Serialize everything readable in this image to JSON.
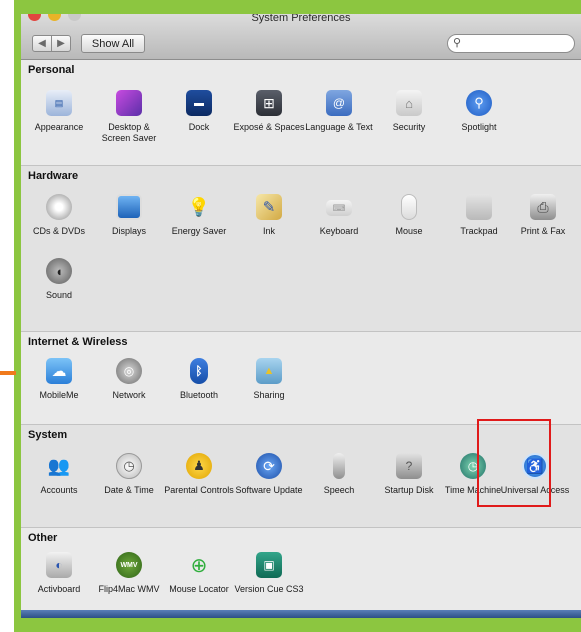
{
  "window": {
    "title": "System Preferences",
    "back_label": "◀",
    "forward_label": "▶",
    "show_all_label": "Show All",
    "search_placeholder": ""
  },
  "colors": {
    "frame_green": "#8cc640",
    "orange_mark": "#f07a1c",
    "highlight_red": "#e01a1a"
  },
  "sections": {
    "personal": {
      "title": "Personal",
      "items": [
        {
          "label": "Appearance",
          "icon": "appearance-icon"
        },
        {
          "label": "Desktop & Screen Saver",
          "icon": "desktop-icon"
        },
        {
          "label": "Dock",
          "icon": "dock-icon"
        },
        {
          "label": "Exposé & Spaces",
          "icon": "expose-icon"
        },
        {
          "label": "Language & Text",
          "icon": "language-icon"
        },
        {
          "label": "Security",
          "icon": "security-icon"
        },
        {
          "label": "Spotlight",
          "icon": "spotlight-icon"
        }
      ]
    },
    "hardware": {
      "title": "Hardware",
      "items": [
        {
          "label": "CDs & DVDs",
          "icon": "cd-icon"
        },
        {
          "label": "Displays",
          "icon": "display-icon"
        },
        {
          "label": "Energy Saver",
          "icon": "lightbulb-icon"
        },
        {
          "label": "Ink",
          "icon": "ink-icon"
        },
        {
          "label": "Keyboard",
          "icon": "keyboard-icon"
        },
        {
          "label": "Mouse",
          "icon": "mouse-icon"
        },
        {
          "label": "Trackpad",
          "icon": "trackpad-icon"
        },
        {
          "label": "Print & Fax",
          "icon": "printer-icon"
        },
        {
          "label": "Sound",
          "icon": "speaker-icon"
        }
      ]
    },
    "internet": {
      "title": "Internet & Wireless",
      "items": [
        {
          "label": "MobileMe",
          "icon": "cloud-icon"
        },
        {
          "label": "Network",
          "icon": "globe-icon"
        },
        {
          "label": "Bluetooth",
          "icon": "bluetooth-icon"
        },
        {
          "label": "Sharing",
          "icon": "folder-icon"
        }
      ]
    },
    "system": {
      "title": "System",
      "items": [
        {
          "label": "Accounts",
          "icon": "users-icon"
        },
        {
          "label": "Date & Time",
          "icon": "clock-icon"
        },
        {
          "label": "Parental Controls",
          "icon": "parental-icon"
        },
        {
          "label": "Software Update",
          "icon": "update-icon"
        },
        {
          "label": "Speech",
          "icon": "microphone-icon"
        },
        {
          "label": "Startup Disk",
          "icon": "disk-icon"
        },
        {
          "label": "Time Machine",
          "icon": "time-machine-icon"
        },
        {
          "label": "Universal Access",
          "icon": "accessibility-icon"
        }
      ]
    },
    "other": {
      "title": "Other",
      "items": [
        {
          "label": "Activboard",
          "icon": "activboard-icon"
        },
        {
          "label": "Flip4Mac WMV",
          "icon": "wmv-icon"
        },
        {
          "label": "Mouse Locator",
          "icon": "locator-icon"
        },
        {
          "label": "Version Cue CS3",
          "icon": "version-cue-icon"
        }
      ]
    }
  }
}
